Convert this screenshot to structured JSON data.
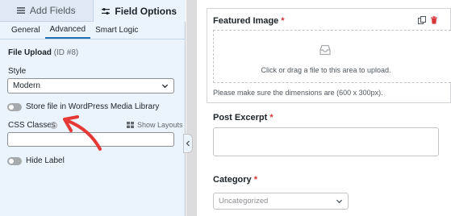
{
  "tabs": [
    {
      "label": "Add Fields",
      "icon": "list-icon",
      "active": false
    },
    {
      "label": "Field Options",
      "icon": "sliders-icon",
      "active": true
    }
  ],
  "subtabs": [
    {
      "label": "General",
      "active": false
    },
    {
      "label": "Advanced",
      "active": true
    },
    {
      "label": "Smart Logic",
      "active": false
    }
  ],
  "field": {
    "title": "File Upload",
    "id_text": "(ID #8)"
  },
  "style": {
    "label": "Style",
    "value": "Modern"
  },
  "media_library_toggle": {
    "label": "Store file in WordPress Media Library",
    "on": false
  },
  "css_classes": {
    "label": "CSS Classes",
    "help": "?",
    "show_layouts": "Show Layouts",
    "value": ""
  },
  "hide_label_toggle": {
    "label": "Hide Label",
    "on": false
  },
  "help_glyph": "?",
  "preview": {
    "featured_image": {
      "label": "Featured Image",
      "required": "*",
      "upload_text": "Click or drag a file to this area to upload.",
      "dimensions_note": "Please make sure the dimensions are (600 x 300px)."
    },
    "post_excerpt": {
      "label": "Post Excerpt",
      "required": "*"
    },
    "category": {
      "label": "Category",
      "required": "*",
      "value": "Uncategorized"
    }
  },
  "colors": {
    "accent": "#2271b1",
    "required": "#d63638",
    "panel_bg": "#ebf3fc",
    "arrow": "#e53935"
  }
}
